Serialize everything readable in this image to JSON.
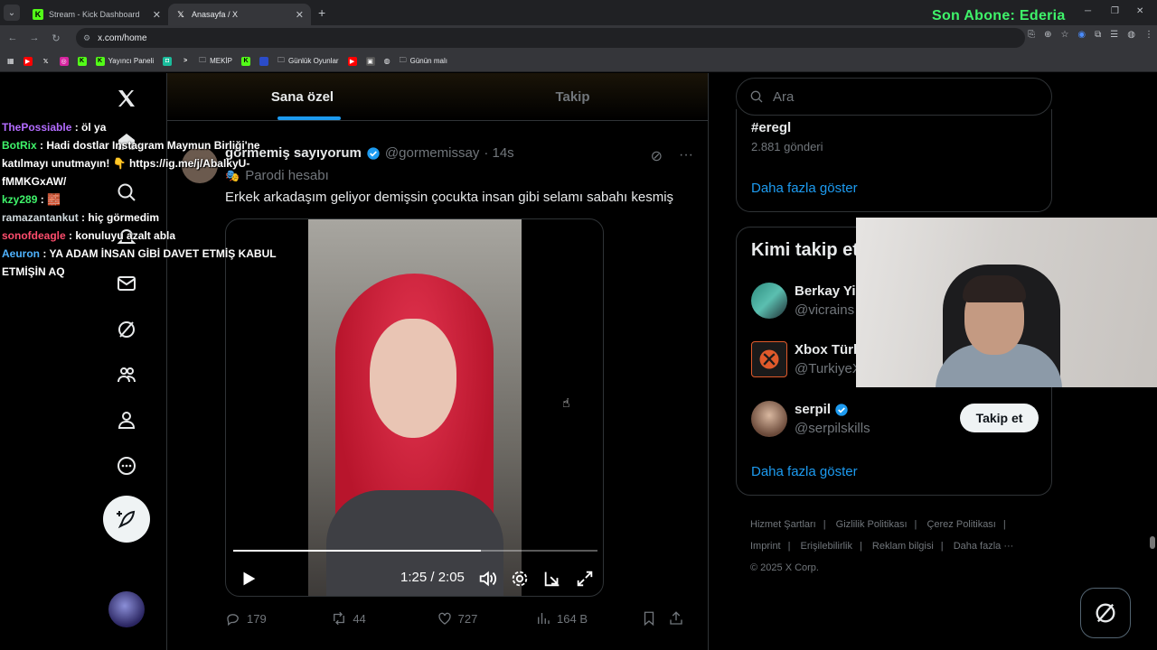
{
  "browser": {
    "tabs": [
      {
        "title": "Stream - Kick Dashboard",
        "active": false
      },
      {
        "title": "Anasayfa / X",
        "active": true
      }
    ],
    "url": "x.com/home",
    "bookmarks": [
      "Yayıncı Paneli",
      "MEKİP",
      "Günlük Oyunlar",
      "Günün malı"
    ]
  },
  "overlay": {
    "son_abone": "Son Abone: Ederia",
    "chat": [
      {
        "user": "ThePossiable",
        "user_color": "#b36cff",
        "msg": ": öl ya"
      },
      {
        "user": "BotRix",
        "user_color": "#3ff36a",
        "msg": ": Hadi dostlar Instagram Maymun Birliği'ne katılmayı unutmayın! 👇 https://ig.me/j/AbalkyU-fMMKGxAW/"
      },
      {
        "user": "kzy289",
        "user_color": "#3ff36a",
        "msg": ": 🧱"
      },
      {
        "user": "ramazantankut",
        "user_color": "#cfd8dc",
        "msg": ": hiç görmedim"
      },
      {
        "user": "sonofdeagle",
        "user_color": "#ff4d6d",
        "msg": ": konuluyu azalt abla"
      },
      {
        "user": "Aeuron",
        "user_color": "#4fb3ff",
        "msg": ": YA ADAM İNSAN GİBİ DAVET ETMİŞ KABUL ETMİŞİN AQ"
      }
    ]
  },
  "feed": {
    "tabs": [
      {
        "label": "Sana özel",
        "active": true
      },
      {
        "label": "Takip",
        "active": false
      }
    ],
    "tweet": {
      "name": "görmemiş sayıyorum",
      "handle": "@gormemissay",
      "time": "· 14s",
      "parody": "Parodi hesabı",
      "text": "Erkek arkadaşım geliyor demişsin çocukta insan gibi selamı sabahı kesmiş",
      "video": {
        "time": "1:25 / 2:05",
        "progress": 0.68
      },
      "stats": {
        "replies": "179",
        "reposts": "44",
        "likes": "727",
        "views": "164 B"
      }
    }
  },
  "sidebar": {
    "search_placeholder": "Ara",
    "trend": {
      "tag": "#eregl",
      "count": "2.881 gönderi"
    },
    "show_more": "Daha fazla göster",
    "who_to_follow": {
      "title": "Kimi takip et",
      "accounts": [
        {
          "name": "Berkay Yi",
          "handle": "@vicrains",
          "verified": false
        },
        {
          "name": "Xbox Türk",
          "handle": "@TurkiyeX",
          "verified": false
        },
        {
          "name": "serpil",
          "handle": "@serpilskills",
          "verified": true
        }
      ],
      "follow_label": "Takip et",
      "show_more": "Daha fazla göster"
    },
    "footer": [
      "Hizmet Şartları",
      "Gizlilik Politikası",
      "Çerez Politikası",
      "Imprint",
      "Erişilebilirlik",
      "Reklam bilgisi",
      "Daha fazla ···",
      "© 2025 X Corp."
    ]
  }
}
